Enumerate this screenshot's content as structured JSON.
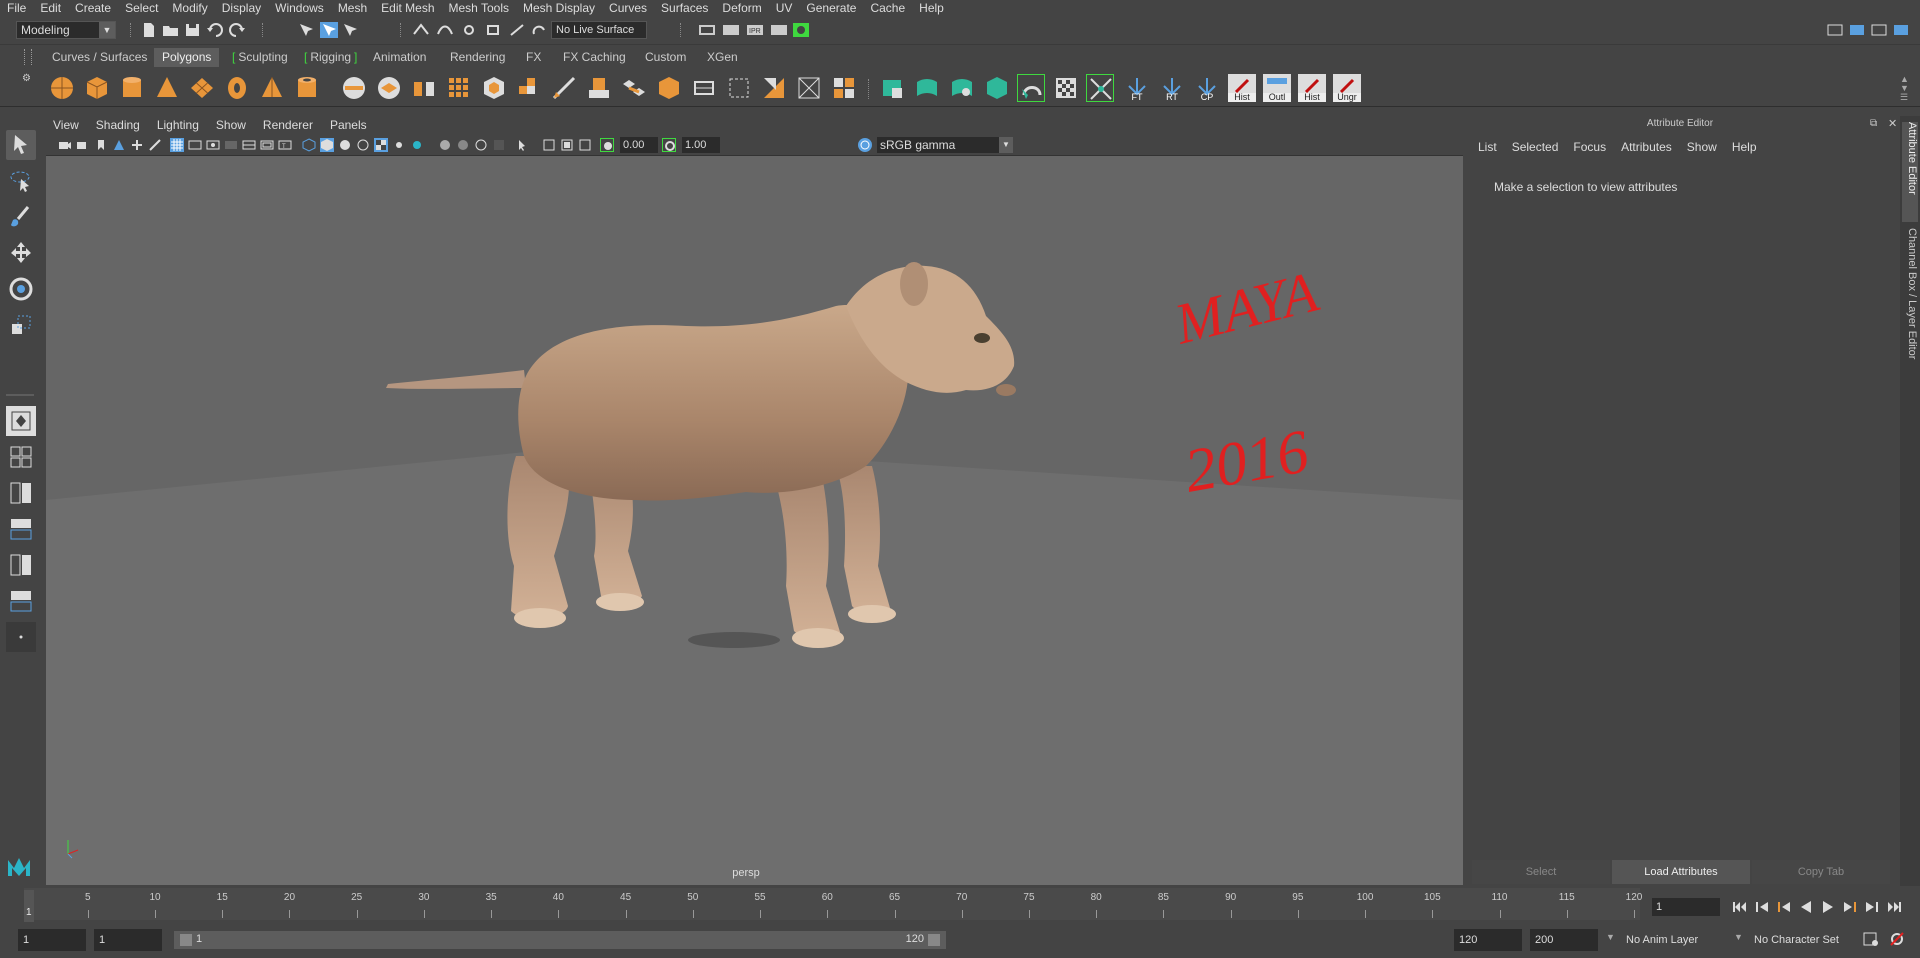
{
  "menubar": {
    "items": [
      "File",
      "Edit",
      "Create",
      "Select",
      "Modify",
      "Display",
      "Windows",
      "Mesh",
      "Edit Mesh",
      "Mesh Tools",
      "Mesh Display",
      "Curves",
      "Surfaces",
      "Deform",
      "UV",
      "Generate",
      "Cache",
      "Help"
    ]
  },
  "status_line": {
    "menu_set": "Modeling",
    "live_surface": "No Live Surface"
  },
  "shelf": {
    "tabs": [
      "Curves / Surfaces",
      "Polygons",
      "Sculpting",
      "Rigging",
      "Animation",
      "Rendering",
      "FX",
      "FX Caching",
      "Custom",
      "XGen"
    ],
    "active_tab": "Polygons",
    "labeled_icons": [
      "FT",
      "RT",
      "CP",
      "Hist",
      "Outl",
      "Hist",
      "Ungr"
    ]
  },
  "viewport": {
    "menu": [
      "View",
      "Shading",
      "Lighting",
      "Show",
      "Renderer",
      "Panels"
    ],
    "exposure": "0.00",
    "gamma": "1.00",
    "color_management": "sRGB gamma",
    "camera": "persp",
    "annotation_line1": "MAYA",
    "annotation_line2": "2016",
    "annotation_color": "#e02020"
  },
  "attribute_editor": {
    "title": "Attribute Editor",
    "menu": [
      "List",
      "Selected",
      "Focus",
      "Attributes",
      "Show",
      "Help"
    ],
    "message": "Make a selection to view attributes",
    "buttons": [
      "Select",
      "Load Attributes",
      "Copy Tab"
    ]
  },
  "side_tabs": [
    "Attribute Editor",
    "Channel Box / Layer Editor"
  ],
  "time_slider": {
    "ticks": [
      5,
      10,
      15,
      20,
      25,
      30,
      35,
      40,
      45,
      50,
      55,
      60,
      65,
      70,
      75,
      80,
      85,
      90,
      95,
      100,
      105,
      110,
      115,
      120
    ],
    "current_frame": "1",
    "current_frame_field": "1"
  },
  "range_slider": {
    "anim_start": "1",
    "playback_start": "1",
    "range_left": "1",
    "range_right": "120",
    "playback_end": "120",
    "anim_end": "200",
    "anim_layer": "No Anim Layer",
    "character_set": "No Character Set"
  },
  "colors": {
    "ui_bg": "#444444",
    "viewport_bg": "#6d6d6d",
    "shelf_orange": "#e8963a",
    "accent_green": "#3fd93f",
    "accent_blue": "#5aa0e0"
  }
}
